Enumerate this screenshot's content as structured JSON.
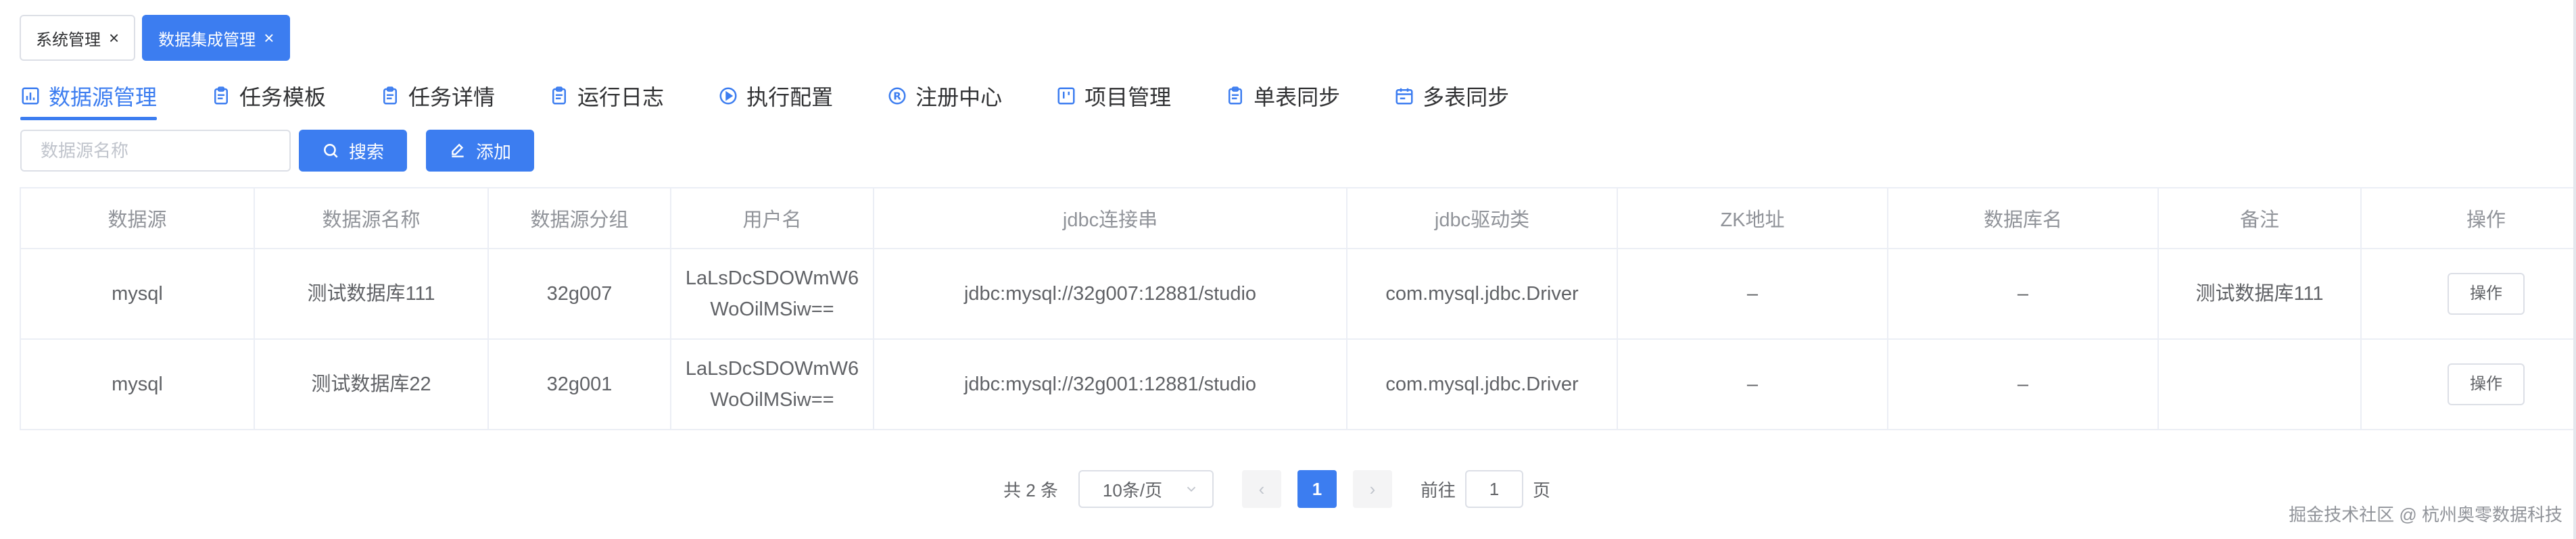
{
  "tags": [
    {
      "label": "系统管理",
      "close": "×"
    },
    {
      "label": "数据集成管理",
      "close": "×"
    }
  ],
  "tabs": [
    {
      "label": "数据源管理",
      "icon": "bar-chart-icon"
    },
    {
      "label": "任务模板",
      "icon": "clipboard-icon"
    },
    {
      "label": "任务详情",
      "icon": "clipboard-icon"
    },
    {
      "label": "运行日志",
      "icon": "clipboard-icon"
    },
    {
      "label": "执行配置",
      "icon": "play-circle-icon"
    },
    {
      "label": "注册中心",
      "icon": "registered-icon"
    },
    {
      "label": "项目管理",
      "icon": "kanban-icon"
    },
    {
      "label": "单表同步",
      "icon": "clipboard-icon"
    },
    {
      "label": "多表同步",
      "icon": "calendar-icon"
    }
  ],
  "toolbar": {
    "search_placeholder": "数据源名称",
    "search_label": "搜索",
    "add_label": "添加"
  },
  "table": {
    "columns": [
      "数据源",
      "数据源名称",
      "数据源分组",
      "用户名",
      "jdbc连接串",
      "jdbc驱动类",
      "ZK地址",
      "数据库名",
      "备注",
      "操作"
    ],
    "rows": [
      {
        "type": "mysql",
        "name": "测试数据库111",
        "group": "32g007",
        "user_l1": "LaLsDcSDOWmW6",
        "user_l2": "WoOilMSiw==",
        "jdbc_url": "jdbc:mysql://32g007:12881/studio",
        "driver": "com.mysql.jdbc.Driver",
        "zk": "–",
        "db": "–",
        "remark": "测试数据库111",
        "action": "操作"
      },
      {
        "type": "mysql",
        "name": "测试数据库22",
        "group": "32g001",
        "user_l1": "LaLsDcSDOWmW6",
        "user_l2": "WoOilMSiw==",
        "jdbc_url": "jdbc:mysql://32g001:12881/studio",
        "driver": "com.mysql.jdbc.Driver",
        "zk": "–",
        "db": "–",
        "remark": "",
        "action": "操作"
      }
    ]
  },
  "pagination": {
    "total_text": "共 2 条",
    "page_size": "10条/页",
    "prev": "‹",
    "current": "1",
    "next": "›",
    "goto_prefix": "前往",
    "goto_value": "1",
    "goto_suffix": "页"
  },
  "watermark": "掘金技术社区 @ 杭州奥零数据科技",
  "colors": {
    "accent": "#3c7df0",
    "border": "#ebeef5"
  }
}
